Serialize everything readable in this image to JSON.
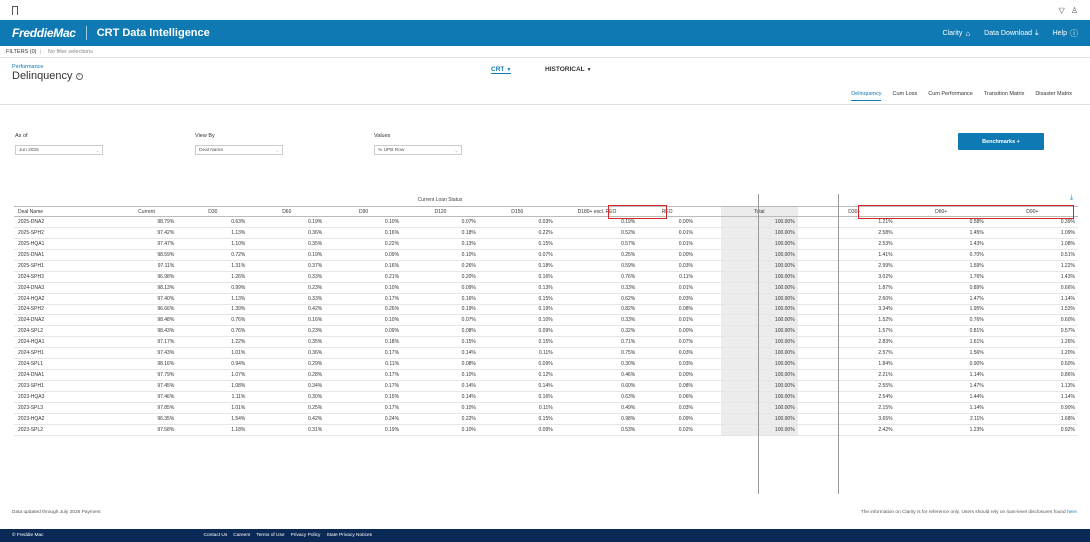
{
  "header": {
    "logo": "FreddieMac",
    "app_title": "CRT Data Intelligence",
    "nav": {
      "clarity": "Clarity",
      "data_download": "Data Download",
      "help": "Help"
    }
  },
  "filters": {
    "label": "FILTERS (0)",
    "value": "No filter selections"
  },
  "page": {
    "section": "Performance",
    "title": "Delinquency"
  },
  "modes": {
    "crt": "CRT",
    "historical": "HISTORICAL"
  },
  "tabs": [
    "Delinquency",
    "Cum Loss",
    "Cum Performance",
    "Transition Matrix",
    "Disaster Matrix"
  ],
  "controls": {
    "as_of": {
      "label": "As of",
      "value": "Jun 2026"
    },
    "view_by": {
      "label": "View By",
      "value": "Deal Name"
    },
    "values": {
      "label": "Values",
      "value": "% UPB Row"
    },
    "benchmarks": "Benchmarks +"
  },
  "table": {
    "group_label": "Current Loan Status",
    "headers": {
      "deal": "Deal Name",
      "current": "Current",
      "d30": "D30",
      "d60": "D60",
      "d90": "D90",
      "d120": "D120",
      "d150": "D150",
      "d180": "D180+ excl. REO",
      "reo": "REO",
      "total": "Total",
      "d30p": "D30+",
      "d60p": "D60+",
      "d90p": "D90+"
    },
    "rows": [
      [
        "2025-DNA2",
        "98.79%",
        "0.63%",
        "0.19%",
        "0.10%",
        "0.07%",
        "0.03%",
        "0.19%",
        "0.00%",
        "100.00%",
        "1.21%",
        "0.58%",
        "0.39%"
      ],
      [
        "2025-SPH2",
        "97.42%",
        "1.13%",
        "0.36%",
        "0.16%",
        "0.18%",
        "0.22%",
        "0.52%",
        "0.01%",
        "100.00%",
        "2.58%",
        "1.45%",
        "1.09%"
      ],
      [
        "2025-HQA1",
        "97.47%",
        "1.10%",
        "0.35%",
        "0.22%",
        "0.13%",
        "0.15%",
        "0.57%",
        "0.01%",
        "100.00%",
        "2.53%",
        "1.43%",
        "1.08%"
      ],
      [
        "2025-DNA1",
        "98.59%",
        "0.72%",
        "0.19%",
        "0.09%",
        "0.10%",
        "0.07%",
        "0.25%",
        "0.00%",
        "100.00%",
        "1.41%",
        "0.70%",
        "0.51%"
      ],
      [
        "2025-SPH1",
        "97.11%",
        "1.31%",
        "0.37%",
        "0.16%",
        "0.26%",
        "0.18%",
        "0.59%",
        "0.03%",
        "100.00%",
        "2.99%",
        "1.59%",
        "1.22%"
      ],
      [
        "2024-SPH3",
        "96.98%",
        "1.26%",
        "0.33%",
        "0.21%",
        "0.20%",
        "0.16%",
        "0.76%",
        "0.11%",
        "100.00%",
        "3.02%",
        "1.76%",
        "1.43%"
      ],
      [
        "2024-DNA3",
        "98.13%",
        "0.99%",
        "0.23%",
        "0.10%",
        "0.09%",
        "0.13%",
        "0.33%",
        "0.01%",
        "100.00%",
        "1.87%",
        "0.89%",
        "0.66%"
      ],
      [
        "2024-HQA2",
        "97.40%",
        "1.13%",
        "0.33%",
        "0.17%",
        "0.16%",
        "0.15%",
        "0.62%",
        "0.03%",
        "100.00%",
        "2.60%",
        "1.47%",
        "1.14%"
      ],
      [
        "2024-SPH2",
        "96.66%",
        "1.39%",
        "0.42%",
        "0.26%",
        "0.19%",
        "0.19%",
        "0.82%",
        "0.08%",
        "100.00%",
        "3.34%",
        "1.95%",
        "1.53%"
      ],
      [
        "2024-DNA2",
        "98.48%",
        "0.76%",
        "0.16%",
        "0.10%",
        "0.07%",
        "0.10%",
        "0.33%",
        "0.01%",
        "100.00%",
        "1.52%",
        "0.76%",
        "0.60%"
      ],
      [
        "2024-SPL2",
        "98.43%",
        "0.76%",
        "0.23%",
        "0.09%",
        "0.08%",
        "0.09%",
        "0.32%",
        "0.00%",
        "100.00%",
        "1.57%",
        "0.81%",
        "0.57%"
      ],
      [
        "2024-HQA1",
        "97.17%",
        "1.22%",
        "0.35%",
        "0.18%",
        "0.15%",
        "0.15%",
        "0.71%",
        "0.07%",
        "100.00%",
        "2.83%",
        "1.61%",
        "1.26%"
      ],
      [
        "2024-SPH1",
        "97.43%",
        "1.01%",
        "0.36%",
        "0.17%",
        "0.14%",
        "0.11%",
        "0.75%",
        "0.03%",
        "100.00%",
        "2.57%",
        "1.56%",
        "1.20%"
      ],
      [
        "2024-SPL1",
        "98.16%",
        "0.94%",
        "0.29%",
        "0.11%",
        "0.08%",
        "0.09%",
        "0.30%",
        "0.03%",
        "100.00%",
        "1.84%",
        "0.90%",
        "0.60%"
      ],
      [
        "2024-DNA1",
        "97.79%",
        "1.07%",
        "0.28%",
        "0.17%",
        "0.10%",
        "0.12%",
        "0.46%",
        "0.00%",
        "100.00%",
        "2.21%",
        "1.14%",
        "0.86%"
      ],
      [
        "2023-SPH1",
        "97.45%",
        "1.08%",
        "0.34%",
        "0.17%",
        "0.14%",
        "0.14%",
        "0.60%",
        "0.08%",
        "100.00%",
        "2.55%",
        "1.47%",
        "1.13%"
      ],
      [
        "2023-HQA3",
        "97.46%",
        "1.11%",
        "0.30%",
        "0.15%",
        "0.14%",
        "0.16%",
        "0.63%",
        "0.06%",
        "100.00%",
        "2.54%",
        "1.44%",
        "1.14%"
      ],
      [
        "2023-SPL3",
        "97.85%",
        "1.01%",
        "0.25%",
        "0.17%",
        "0.10%",
        "0.11%",
        "0.49%",
        "0.03%",
        "100.00%",
        "2.15%",
        "1.14%",
        "0.90%"
      ],
      [
        "2023-HQA2",
        "96.35%",
        "1.54%",
        "0.42%",
        "0.24%",
        "0.22%",
        "0.15%",
        "0.98%",
        "0.09%",
        "100.00%",
        "3.65%",
        "2.11%",
        "1.68%"
      ],
      [
        "2023-SPL2",
        "97.58%",
        "1.18%",
        "0.31%",
        "0.19%",
        "0.10%",
        "0.09%",
        "0.53%",
        "0.02%",
        "100.00%",
        "2.42%",
        "1.23%",
        "0.92%"
      ]
    ]
  },
  "notes": {
    "left": "Data updated through July 2026 Payment",
    "right": "The information on Clarity is for reference only. Users should rely on loan-level disclosures found",
    "right_link": "here."
  },
  "footer": {
    "brand": "© Freddie Mac",
    "links": [
      "Contact Us",
      "Careers",
      "Terms of Use",
      "Privacy Policy",
      "State Privacy Notices"
    ]
  },
  "icons": {
    "bookmark": "bookmark-icon",
    "filter": "filter-icon",
    "user": "user-icon",
    "home": "home-icon",
    "download": "download-icon",
    "help": "help-icon"
  },
  "colors": {
    "brand": "#0e79b2",
    "highlight_box": "#d9252a",
    "footer": "#0a2a55"
  }
}
